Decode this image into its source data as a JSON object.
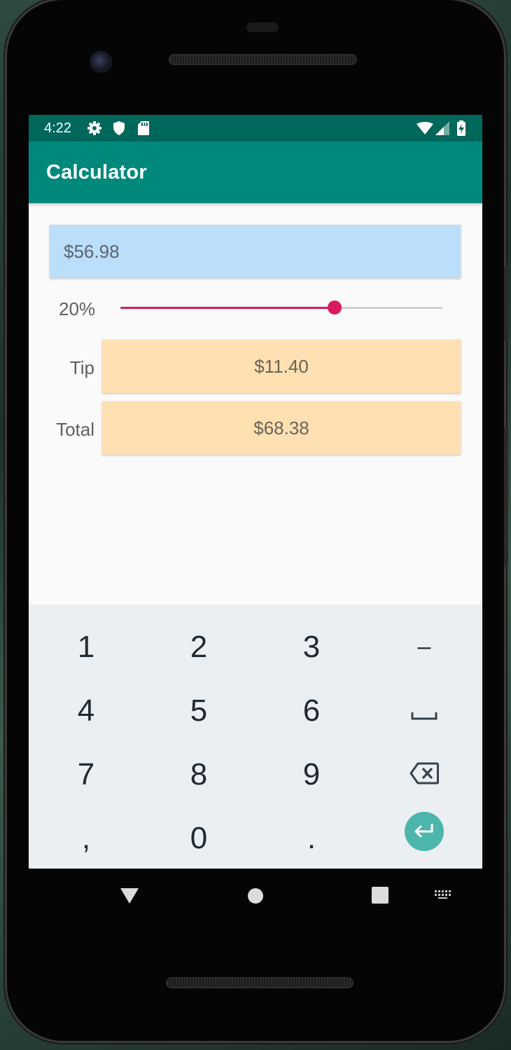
{
  "status_bar": {
    "time": "4:22",
    "left_icons": [
      "gear-icon",
      "shield-icon",
      "sd-card-icon"
    ],
    "right_icons": [
      "wifi-icon",
      "signal-icon",
      "battery-charging-icon"
    ]
  },
  "app_bar": {
    "title": "Calculator"
  },
  "bill": {
    "value": "$56.98"
  },
  "tip_percent": {
    "label": "20%",
    "slider_level": 0.665
  },
  "tip": {
    "label": "Tip",
    "value": "$11.40"
  },
  "total": {
    "label": "Total",
    "value": "$68.38"
  },
  "keyboard": {
    "rows": [
      [
        "1",
        "2",
        "3",
        "–"
      ],
      [
        "4",
        "5",
        "6",
        "space-icon"
      ],
      [
        "7",
        "8",
        "9",
        "backspace-icon"
      ],
      [
        ",",
        "0",
        ".",
        "enter-icon"
      ]
    ]
  },
  "colors": {
    "primary_dark": "#00675b",
    "primary": "#00897b",
    "accent": "#d81b60",
    "bill_background": "#bbdefb",
    "output_background": "#ffe0b2",
    "keyboard_background": "#eceff1",
    "enter_key": "#4db6ac"
  },
  "nav_bar": {
    "icons": [
      "back-icon",
      "home-icon",
      "recents-icon",
      "keyboard-switch-icon"
    ]
  }
}
